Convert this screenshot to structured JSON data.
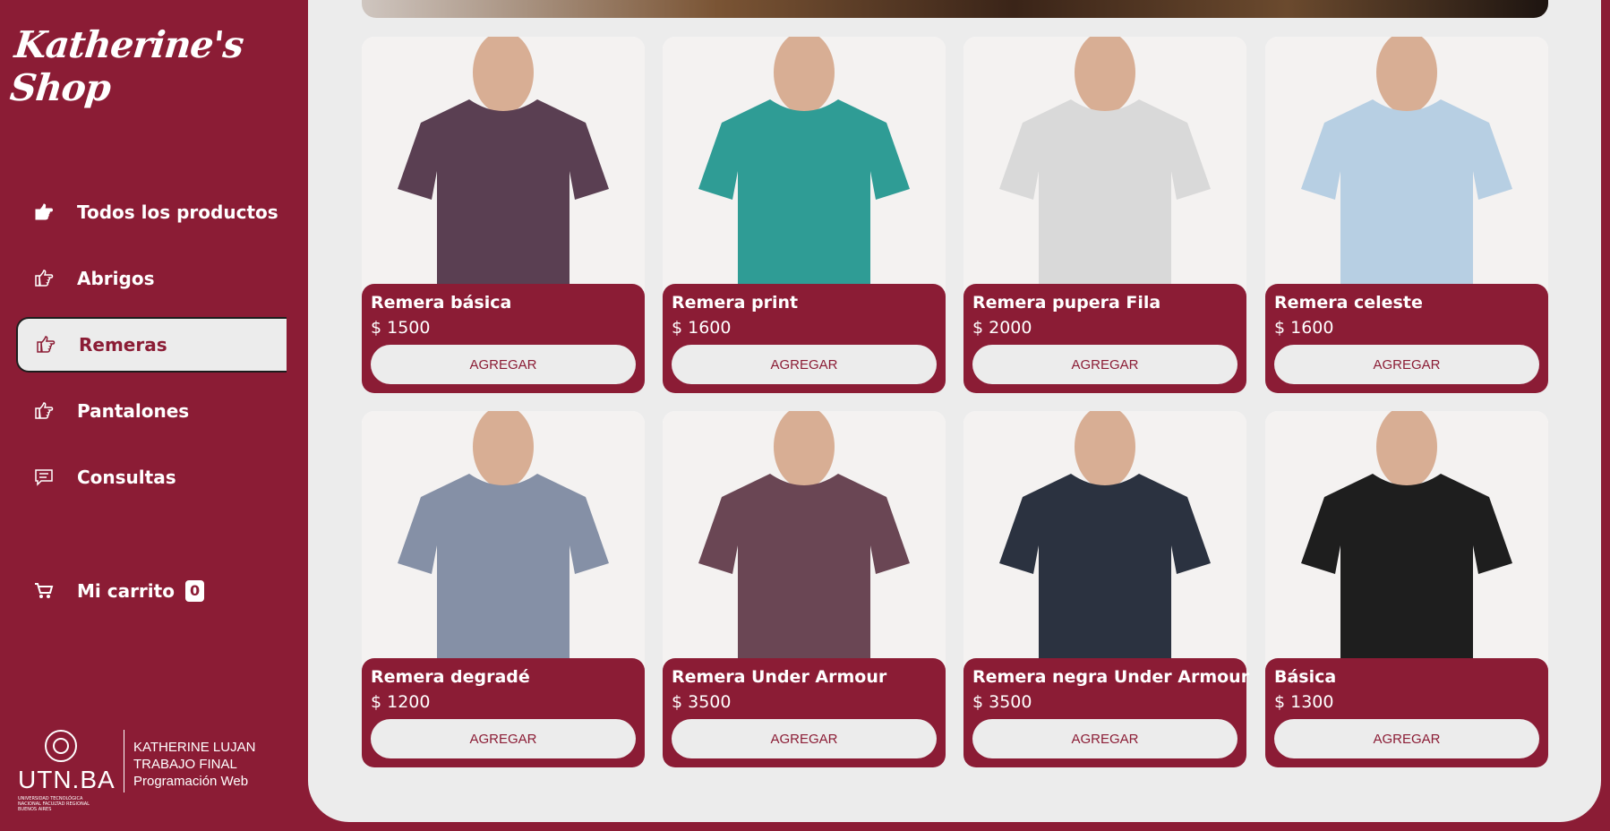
{
  "brand": {
    "name": "Katherine's Shop"
  },
  "sidebar": {
    "items": [
      {
        "label": "Todos los productos",
        "icon": "pointing-hand-icon"
      },
      {
        "label": "Abrigos",
        "icon": "pointing-hand-icon"
      },
      {
        "label": "Remeras",
        "icon": "pointing-hand-icon",
        "active": true
      },
      {
        "label": "Pantalones",
        "icon": "pointing-hand-icon"
      },
      {
        "label": "Consultas",
        "icon": "chat-icon"
      }
    ],
    "cart": {
      "label": "Mi carrito",
      "count": "0",
      "icon": "cart-icon"
    }
  },
  "footer": {
    "utn_logo": "UTN.BA",
    "utn_subtitle": "UNIVERSIDAD TECNOLÓGICA NACIONAL FACULTAD REGIONAL BUENOS AIRES",
    "lines": [
      "KATHERINE LUJAN",
      "TRABAJO FINAL",
      "Programación Web"
    ]
  },
  "products": [
    {
      "name": "Remera básica",
      "price": "$ 1500",
      "button": "AGREGAR",
      "color": "#5a3f52"
    },
    {
      "name": "Remera print",
      "price": "$ 1600",
      "button": "AGREGAR",
      "color": "#2f9c95"
    },
    {
      "name": "Remera pupera Fila",
      "price": "$ 2000",
      "button": "AGREGAR",
      "color": "#d9d9d9"
    },
    {
      "name": "Remera celeste",
      "price": "$ 1600",
      "button": "AGREGAR",
      "color": "#b7cfe3"
    },
    {
      "name": "Remera degradé",
      "price": "$ 1200",
      "button": "AGREGAR",
      "color": "#8590a6"
    },
    {
      "name": "Remera Under Armour",
      "price": "$ 3500",
      "button": "AGREGAR",
      "color": "#6a4654"
    },
    {
      "name": "Remera negra Under Armour",
      "price": "$ 3500",
      "button": "AGREGAR",
      "color": "#2b3240"
    },
    {
      "name": "Básica",
      "price": "$ 1300",
      "button": "AGREGAR",
      "color": "#1e1e1e"
    }
  ],
  "colors": {
    "brand": "#8b1c35",
    "panel": "#ececec"
  }
}
